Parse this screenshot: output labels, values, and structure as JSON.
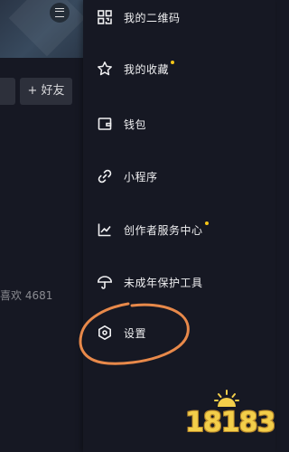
{
  "background_profile": {
    "add_friend_label": "+ 好友",
    "likes_text": "喜欢 4681"
  },
  "drawer": {
    "items": [
      {
        "label": "我的二维码",
        "icon": "qr-code-icon",
        "dot": false
      },
      {
        "label": "我的收藏",
        "icon": "star-icon",
        "dot": true
      },
      {
        "label": "钱包",
        "icon": "wallet-icon",
        "dot": false
      },
      {
        "label": "小程序",
        "icon": "link-icon",
        "dot": false
      },
      {
        "label": "创作者服务中心",
        "icon": "trend-chart-icon",
        "dot": true
      },
      {
        "label": "未成年保护工具",
        "icon": "umbrella-icon",
        "dot": false
      },
      {
        "label": "设置",
        "icon": "hexagon-gear-icon",
        "dot": false
      }
    ]
  },
  "watermark": {
    "text": "18183"
  },
  "colors": {
    "background": "#161823",
    "notification_dot": "#f5c518",
    "annotation": "#e8894a",
    "watermark": "#f3ce4a"
  }
}
